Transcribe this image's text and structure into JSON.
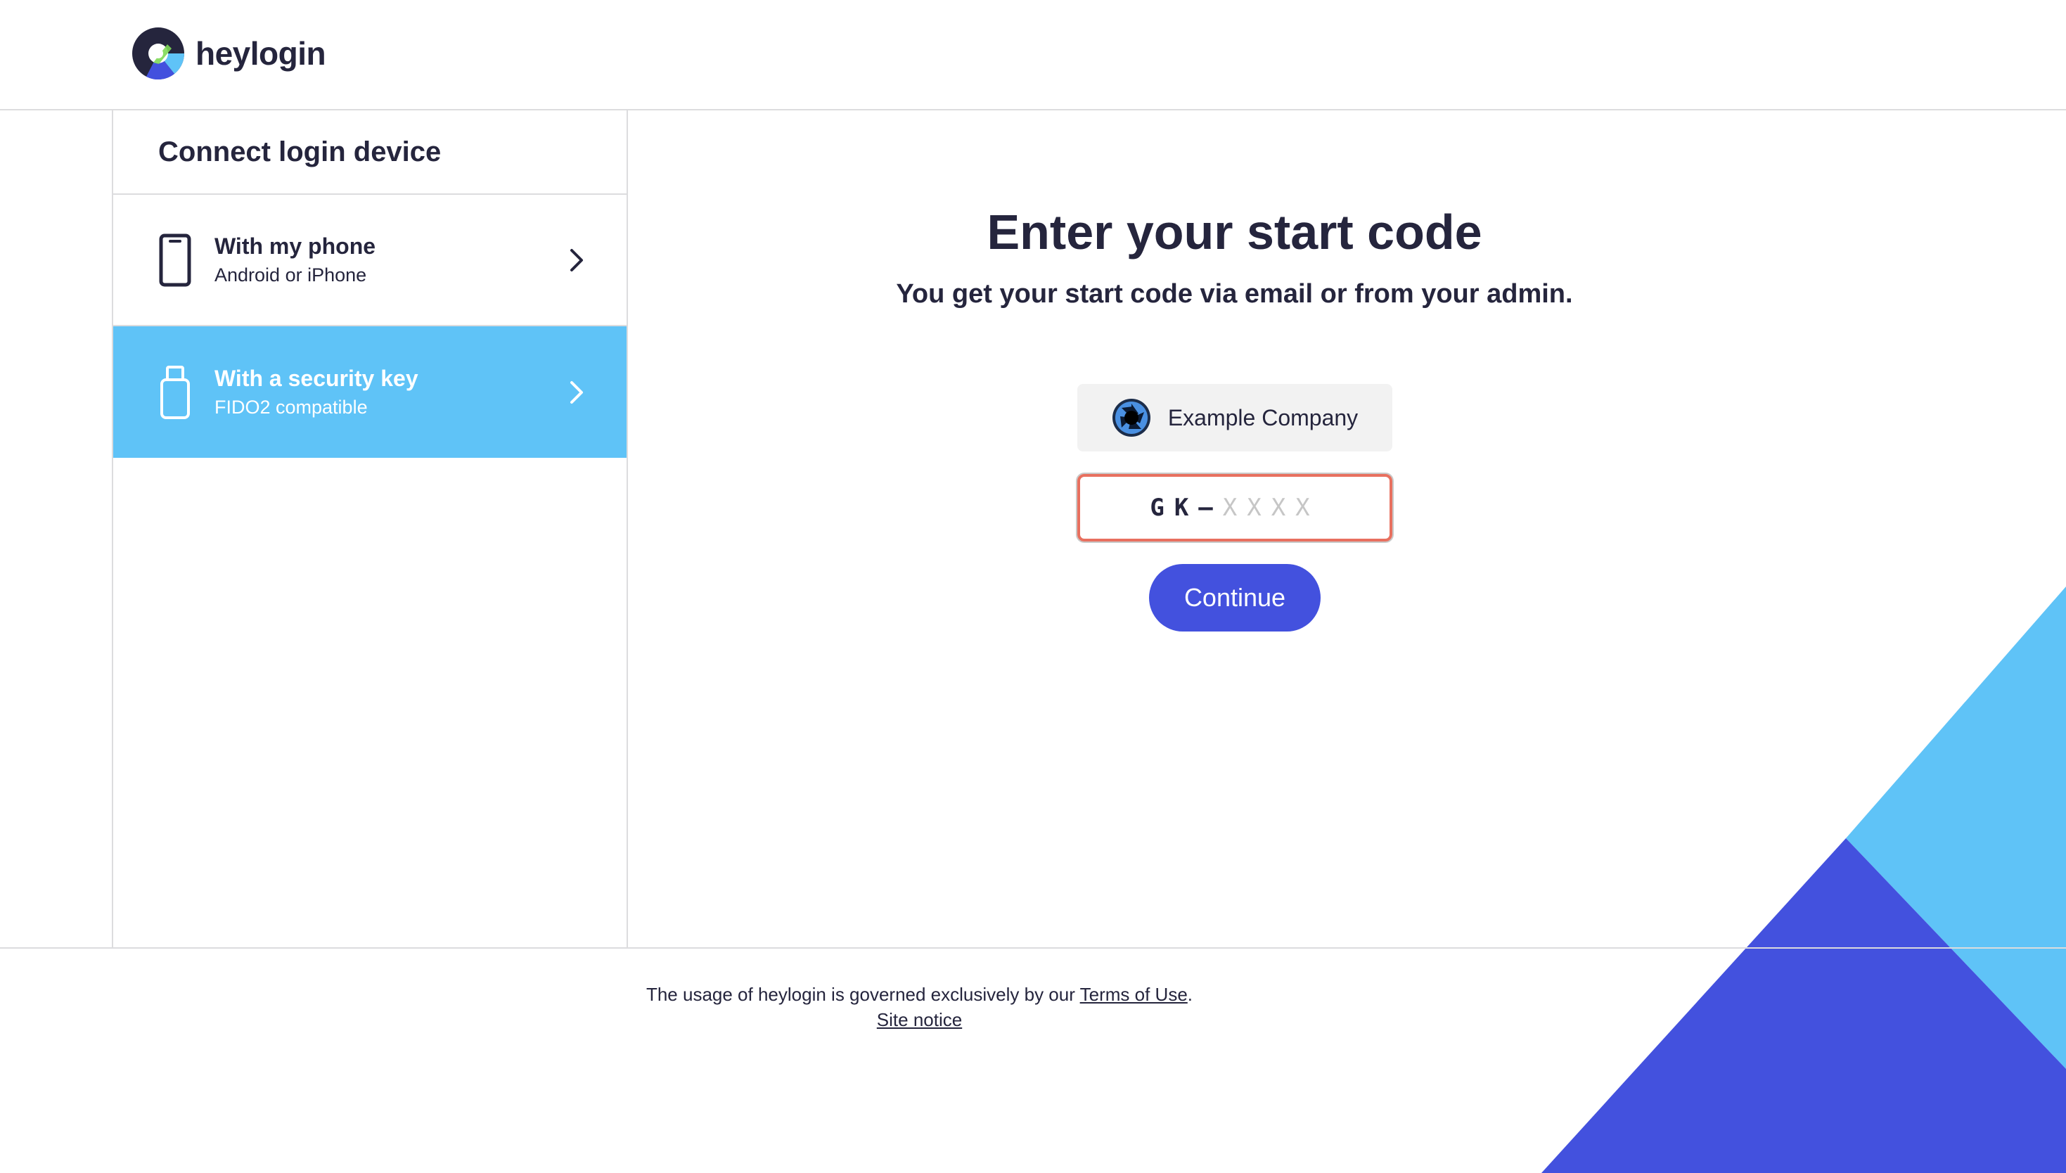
{
  "brand": {
    "name": "heylogin",
    "colors": {
      "dark": "#25253d",
      "light_blue": "#5fc3f7",
      "indigo": "#4351de",
      "error_border": "#e8705f"
    }
  },
  "sidebar": {
    "title": "Connect login device",
    "options": [
      {
        "title": "With my phone",
        "subtitle": "Android or iPhone",
        "icon": "phone-icon",
        "selected": false
      },
      {
        "title": "With a security key",
        "subtitle": "FIDO2 compatible",
        "icon": "usb-key-icon",
        "selected": true
      }
    ]
  },
  "main": {
    "title": "Enter your start code",
    "subtitle": "You get your start code via email or from your admin.",
    "company": {
      "name": "Example Company",
      "icon": "aperture-icon"
    },
    "code_input": {
      "prefix": "GK–",
      "placeholder": "XXXX",
      "value": ""
    },
    "continue_label": "Continue"
  },
  "footer": {
    "text_before": "The usage of heylogin is governed exclusively by our ",
    "terms_link": "Terms of Use",
    "text_after": ".",
    "site_notice": "Site notice"
  }
}
